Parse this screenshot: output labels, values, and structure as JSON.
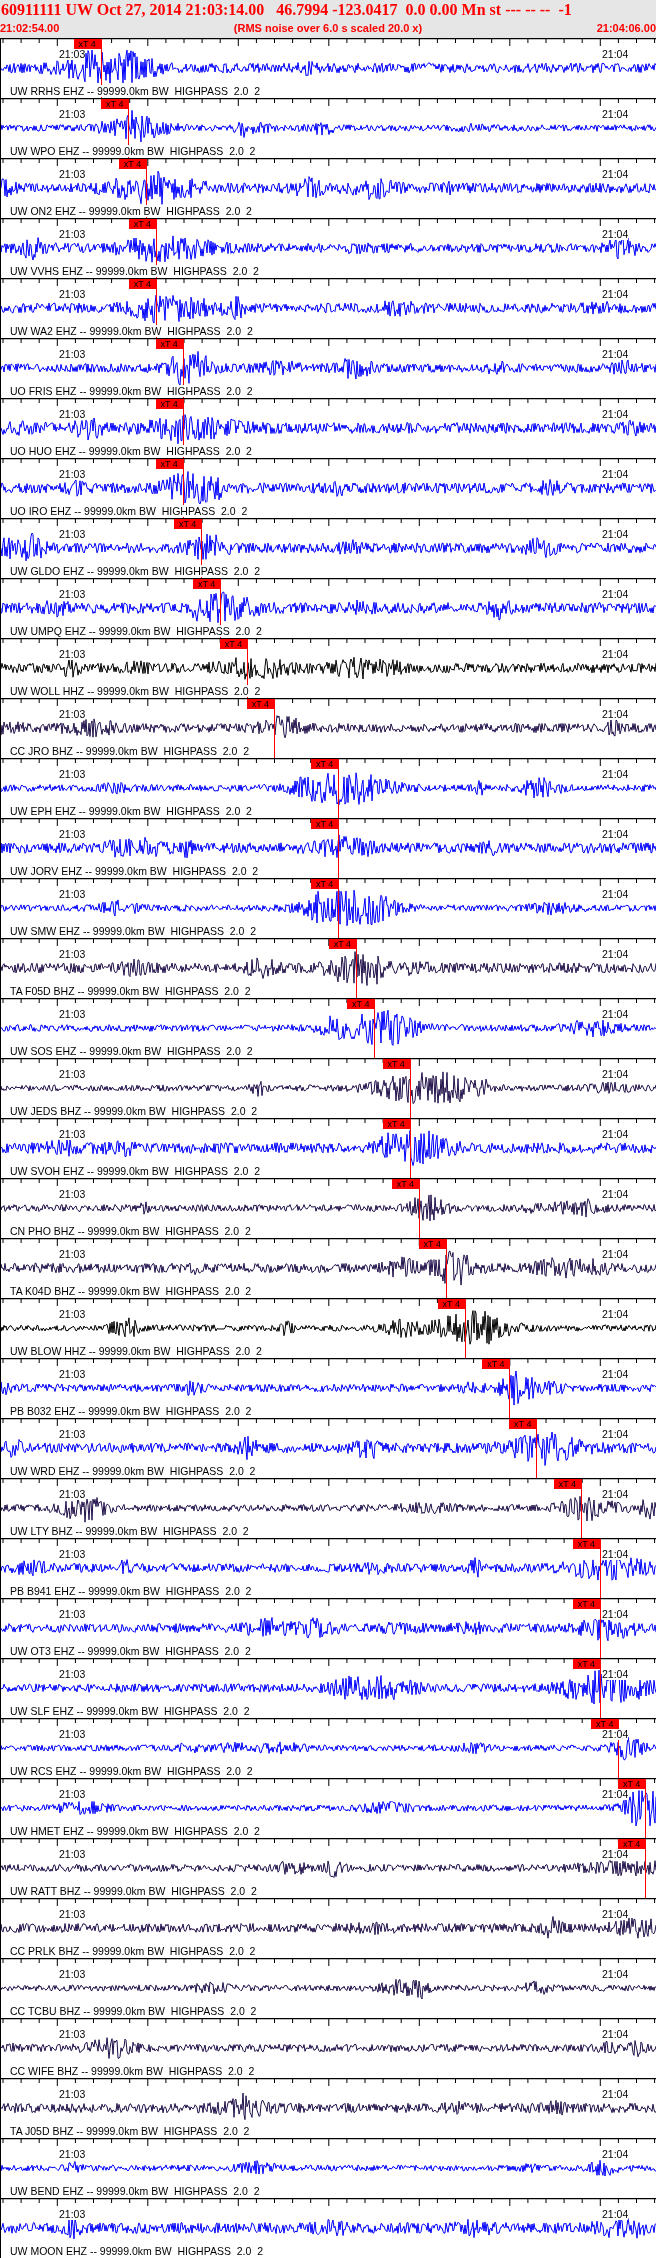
{
  "header": {
    "title": "60911111 UW Oct 27, 2014 21:03:14.00   46.7994 -123.0417  0.0 0.00 Mn st --- -- --  -1",
    "start_time": "21:02:54.00",
    "note": "(RMS noise over 6.0 s scaled 20.0 x)",
    "end_time": "21:04:06.00"
  },
  "traces": [
    {
      "label": "UW RRHS EHZ -- 99999.0km BW  HIGHPASS  2.0  2",
      "time_left": "21:03",
      "time_right": "21:04",
      "color": "#0000ff",
      "pick": {
        "label": "xT 4",
        "level": 0.152
      }
    },
    {
      "label": "UW WPO EHZ -- 99999.0km BW  HIGHPASS  2.0  2",
      "time_left": "21:03",
      "time_right": "21:04",
      "color": "#0000ff",
      "pick": {
        "label": "xT 4",
        "level": 0.194
      }
    },
    {
      "label": "UW ON2 EHZ -- 99999.0km BW  HIGHPASS  2.0  2",
      "time_left": "21:03",
      "time_right": "21:04",
      "color": "#0000ff",
      "pick": {
        "label": "xT 4",
        "level": 0.221
      }
    },
    {
      "label": "UW VVHS EHZ -- 99999.0km BW  HIGHPASS  2.0  2",
      "time_left": "21:03",
      "time_right": "21:04",
      "color": "#0000ff",
      "pick": {
        "label": "xT 4",
        "level": 0.236
      }
    },
    {
      "label": "UW WA2 EHZ -- 99999.0km BW  HIGHPASS  2.0  2",
      "time_left": "21:03",
      "time_right": "21:04",
      "color": "#0000ff",
      "pick": {
        "label": "xT 4",
        "level": 0.236
      }
    },
    {
      "label": "UO FRIS EHZ -- 99999.0km BW  HIGHPASS  2.0  2",
      "time_left": "21:03",
      "time_right": "21:04",
      "color": "#0000ff",
      "pick": {
        "label": "xT 4",
        "level": 0.277
      }
    },
    {
      "label": "UO HUO EHZ -- 99999.0km BW  HIGHPASS  2.0  2",
      "time_left": "21:03",
      "time_right": "21:04",
      "color": "#0000ff",
      "pick": {
        "label": "xT 4",
        "level": 0.277
      }
    },
    {
      "label": "UO IRO EHZ -- 99999.0km BW  HIGHPASS  2.0  2",
      "time_left": "21:03",
      "time_right": "21:04",
      "color": "#0000ff",
      "pick": {
        "label": "xT 4",
        "level": 0.277
      }
    },
    {
      "label": "UW GLDO EHZ -- 99999.0km BW  HIGHPASS  2.0  2",
      "time_left": "21:03",
      "time_right": "21:04",
      "color": "#0000ff",
      "pick": {
        "label": "xT 4",
        "level": 0.305
      }
    },
    {
      "label": "UW UMPQ EHZ -- 99999.0km BW  HIGHPASS  2.0  2",
      "time_left": "21:03",
      "time_right": "21:04",
      "color": "#0000ff",
      "pick": {
        "label": "xT 4",
        "level": 0.334
      }
    },
    {
      "label": "UW WOLL HHZ -- 99999.0km BW  HIGHPASS  2.0  2",
      "time_left": "21:03",
      "time_right": "21:04",
      "color": "#000000",
      "pick": {
        "label": "xT 4",
        "level": 0.375
      }
    },
    {
      "label": "CC JRO BHZ -- 99999.0km BW  HIGHPASS  2.0  2",
      "time_left": "21:03",
      "time_right": "21:04",
      "color": "#20104a",
      "pick": {
        "label": "xT 4",
        "level": 0.416
      }
    },
    {
      "label": "UW EPH EHZ -- 99999.0km BW  HIGHPASS  2.0  2",
      "time_left": "21:03",
      "time_right": "21:04",
      "color": "#0000ff",
      "pick": {
        "label": "xT 4",
        "level": 0.514
      }
    },
    {
      "label": "UW JORV EHZ -- 99999.0km BW  HIGHPASS  2.0  2",
      "time_left": "21:03",
      "time_right": "21:04",
      "color": "#0000ff",
      "pick": {
        "label": "xT 4",
        "level": 0.514
      }
    },
    {
      "label": "UW SMW EHZ -- 99999.0km BW  HIGHPASS  2.0  2",
      "time_left": "21:03",
      "time_right": "21:04",
      "color": "#0000ff",
      "pick": {
        "label": "xT 4",
        "level": 0.514
      }
    },
    {
      "label": "TA F05D BHZ -- 99999.0km BW  HIGHPASS  2.0  2",
      "time_left": "21:03",
      "time_right": "21:04",
      "color": "#20104a",
      "pick": {
        "label": "xT 4",
        "level": 0.541
      }
    },
    {
      "label": "UW SOS EHZ -- 99999.0km BW  HIGHPASS  2.0  2",
      "time_left": "21:03",
      "time_right": "21:04",
      "color": "#0000ff",
      "pick": {
        "label": "xT 4",
        "level": 0.569
      }
    },
    {
      "label": "UW JEDS BHZ -- 99999.0km BW  HIGHPASS  2.0  2",
      "time_left": "21:03",
      "time_right": "21:04",
      "color": "#20104a",
      "pick": {
        "label": "xT 4",
        "level": 0.623
      }
    },
    {
      "label": "UW SVOH EHZ -- 99999.0km BW  HIGHPASS  2.0  2",
      "time_left": "21:03",
      "time_right": "21:04",
      "color": "#0000ff",
      "pick": {
        "label": "xT 4",
        "level": 0.623
      }
    },
    {
      "label": "CN PHO BHZ -- 99999.0km BW  HIGHPASS  2.0  2",
      "time_left": "21:03",
      "time_right": "21:04",
      "color": "#20104a",
      "pick": {
        "label": "xT 4",
        "level": 0.637
      }
    },
    {
      "label": "TA K04D BHZ -- 99999.0km BW  HIGHPASS  2.0  2",
      "time_left": "21:03",
      "time_right": "21:04",
      "color": "#20104a",
      "pick": {
        "label": "xT 4",
        "level": 0.678
      }
    },
    {
      "label": "UW BLOW HHZ -- 99999.0km BW  HIGHPASS  2.0  2",
      "time_left": "21:03",
      "time_right": "21:04",
      "color": "#000000",
      "pick": {
        "label": "xT 4",
        "level": 0.707
      }
    },
    {
      "label": "PB B032 EHZ -- 99999.0km BW  HIGHPASS  2.0  2",
      "time_left": "21:03",
      "time_right": "21:04",
      "color": "#0000ff",
      "pick": {
        "label": "xT 4",
        "level": 0.775
      }
    },
    {
      "label": "UW WRD EHZ -- 99999.0km BW  HIGHPASS  2.0  2",
      "time_left": "21:03",
      "time_right": "21:04",
      "color": "#0000ff",
      "pick": {
        "label": "xT 4",
        "level": 0.816
      }
    },
    {
      "label": "UW LTY BHZ -- 99999.0km BW  HIGHPASS  2.0  2",
      "time_left": "21:03",
      "time_right": "21:04",
      "color": "#20104a",
      "pick": {
        "label": "xT 4",
        "level": 0.884
      }
    },
    {
      "label": "PB B941 EHZ -- 99999.0km BW  HIGHPASS  2.0  2",
      "time_left": "21:03",
      "time_right": "21:04",
      "color": "#0000ff",
      "pick": {
        "label": "xT 4",
        "level": 0.913
      }
    },
    {
      "label": "UW OT3 EHZ -- 99999.0km BW  HIGHPASS  2.0  2",
      "time_left": "21:03",
      "time_right": "21:04",
      "color": "#0000ff",
      "pick": {
        "label": "xT 4",
        "level": 0.913
      }
    },
    {
      "label": "UW SLF EHZ -- 99999.0km BW  HIGHPASS  2.0  2",
      "time_left": "21:03",
      "time_right": "21:04",
      "color": "#0000ff",
      "pick": {
        "label": "xT 4",
        "level": 0.913
      }
    },
    {
      "label": "UW RCS EHZ -- 99999.0km BW  HIGHPASS  2.0  2",
      "time_left": "21:03",
      "time_right": "21:04",
      "color": "#0000ff",
      "pick": {
        "label": "xT 4",
        "level": 0.941
      }
    },
    {
      "label": "UW HMET EHZ -- 99999.0km BW  HIGHPASS  2.0  2",
      "time_left": "21:03",
      "time_right": "21:04",
      "color": "#0000ff",
      "pick": {
        "label": "xT 4",
        "level": 0.982
      }
    },
    {
      "label": "UW RATT BHZ -- 99999.0km BW  HIGHPASS  2.0  2",
      "time_left": "21:03",
      "time_right": "21:04",
      "color": "#20104a",
      "pick": {
        "label": "xT 4",
        "level": 0.982
      }
    },
    {
      "label": "CC PRLK BHZ -- 99999.0km BW  HIGHPASS  2.0  2",
      "time_left": "21:03",
      "time_right": "21:04",
      "color": "#20104a"
    },
    {
      "label": "CC TCBU BHZ -- 99999.0km BW  HIGHPASS  2.0  2",
      "time_left": "21:03",
      "time_right": "21:04",
      "color": "#20104a"
    },
    {
      "label": "CC WIFE BHZ -- 99999.0km BW  HIGHPASS  2.0  2",
      "time_left": "21:03",
      "time_right": "21:04",
      "color": "#20104a"
    },
    {
      "label": "TA J05D BHZ -- 99999.0km BW  HIGHPASS  2.0  2",
      "time_left": "21:03",
      "time_right": "21:04",
      "color": "#20104a"
    },
    {
      "label": "UW BEND EHZ -- 99999.0km BW  HIGHPASS  2.0  2",
      "time_left": "21:03",
      "time_right": "21:04",
      "color": "#0000ff"
    },
    {
      "label": "UW MOON EHZ -- 99999.0km BW  HIGHPASS  2.0  2",
      "time_left": "21:03",
      "time_right": "21:04",
      "color": "#0000ff"
    }
  ]
}
